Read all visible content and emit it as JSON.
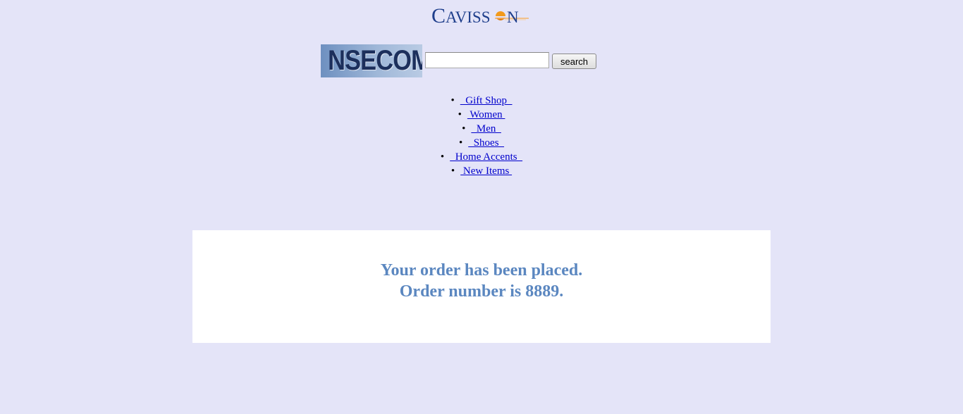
{
  "header": {
    "logo_text": "Cavisson",
    "banner_text": "NSECOM"
  },
  "search": {
    "value": "",
    "placeholder": "",
    "button_label": "search"
  },
  "nav": {
    "items": [
      {
        "label": "  Gift Shop  "
      },
      {
        "label": " Women "
      },
      {
        "label": "  Men  "
      },
      {
        "label": "  Shoes  "
      },
      {
        "label": "  Home Accents  "
      },
      {
        "label": " New Items "
      }
    ]
  },
  "confirmation": {
    "line1": "Your order has been placed.",
    "line2": "Order number is 8889."
  },
  "colors": {
    "background": "#e4e4f8",
    "link": "#0000cc",
    "message": "#5b87c0",
    "logo": "#1f3f8c",
    "sun": "#f29a1d"
  }
}
